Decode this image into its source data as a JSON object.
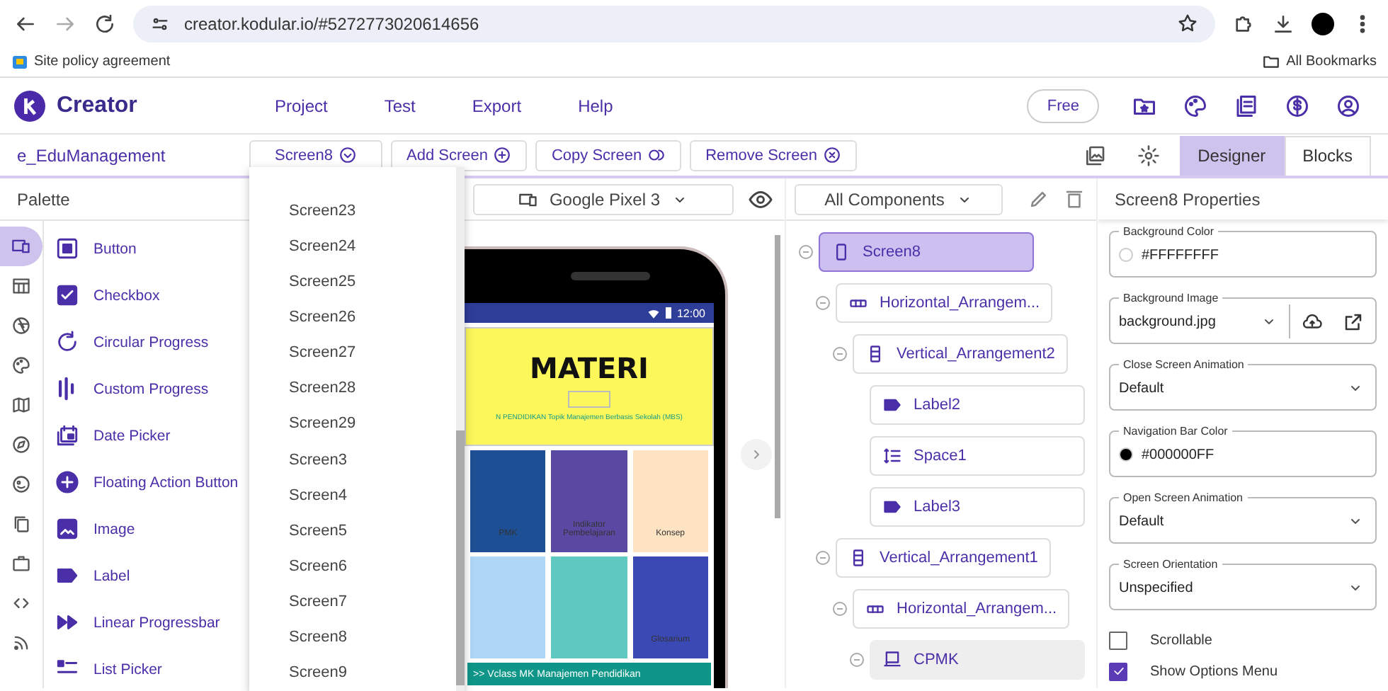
{
  "browser": {
    "url": "creator.kodular.io/#5272773020614656",
    "bookmark": "Site policy agreement",
    "all_bookmarks": "All Bookmarks"
  },
  "header": {
    "brand": "Creator",
    "menu": [
      "Project",
      "Test",
      "Export",
      "Help"
    ],
    "plan": "Free"
  },
  "toolbar": {
    "project": "e_EduManagement",
    "current_screen": "Screen8",
    "actions": [
      {
        "label": "Add Screen",
        "kind": "add"
      },
      {
        "label": "Copy Screen",
        "kind": "copy"
      },
      {
        "label": "Remove Screen",
        "kind": "remove"
      }
    ],
    "views": [
      {
        "label": "Designer",
        "selected": true
      },
      {
        "label": "Blocks",
        "selected": false
      }
    ]
  },
  "palette": {
    "title": "Palette",
    "categories": [
      {
        "kind": "devices",
        "selected": true
      },
      {
        "kind": "table",
        "selected": false
      },
      {
        "kind": "aperture",
        "selected": false
      },
      {
        "kind": "palette",
        "selected": false
      },
      {
        "kind": "map",
        "selected": false
      },
      {
        "kind": "compass",
        "selected": false
      },
      {
        "kind": "face",
        "selected": false
      },
      {
        "kind": "copy",
        "selected": false
      },
      {
        "kind": "briefcase",
        "selected": false
      },
      {
        "kind": "code",
        "selected": false
      },
      {
        "kind": "rss",
        "selected": false
      }
    ],
    "items": [
      {
        "label": "Button",
        "kind": "button"
      },
      {
        "label": "Checkbox",
        "kind": "checkbox"
      },
      {
        "label": "Circular Progress",
        "kind": "circular"
      },
      {
        "label": "Custom Progress",
        "kind": "bars"
      },
      {
        "label": "Date Picker",
        "kind": "date"
      },
      {
        "label": "Floating Action Button",
        "kind": "fab"
      },
      {
        "label": "Image",
        "kind": "image"
      },
      {
        "label": "Label",
        "kind": "label"
      },
      {
        "label": "Linear Progressbar",
        "kind": "linear"
      },
      {
        "label": "List Picker",
        "kind": "list"
      }
    ]
  },
  "screen_menu": [
    "Screen23",
    "Screen24",
    "Screen25",
    "Screen26",
    "Screen27",
    "Screen28",
    "Screen29",
    "Screen3",
    "Screen4",
    "Screen5",
    "Screen6",
    "Screen7",
    "Screen8",
    "Screen9"
  ],
  "viewer": {
    "device": "Google Pixel 3",
    "phone": {
      "time": "12:00",
      "title": "MATERI",
      "subtitle": "N PENDIDIKAN Topik Manajemen Berbasis Sekolah (MBS)",
      "tiles": [
        {
          "label": "PMK",
          "color": "#1d4f94"
        },
        {
          "label": "Indikator Pembelajaran",
          "color": "#5a49a3"
        },
        {
          "label": "Konsep",
          "color": "#fde3c2"
        },
        {
          "color": "#aed6f5"
        },
        {
          "color": "#5ec9bf"
        },
        {
          "label": "Glosarium",
          "color": "#3b49b5"
        }
      ],
      "footer": ">> Vclass MK Manajemen Pendidikan"
    }
  },
  "components": {
    "filter": "All Components",
    "tree": [
      {
        "name": "Screen8",
        "kind": "screen",
        "selected": true,
        "expanded": true,
        "children": [
          {
            "name": "Horizontal_Arrangem...",
            "kind": "horizontal",
            "selected": false,
            "expanded": true,
            "children": [
              {
                "name": "Vertical_Arrangement2",
                "kind": "vertical",
                "selected": false,
                "expanded": true,
                "children": [
                  {
                    "name": "Label2",
                    "kind": "label",
                    "selected": false
                  },
                  {
                    "name": "Space1",
                    "kind": "space",
                    "selected": false
                  },
                  {
                    "name": "Label3",
                    "kind": "label",
                    "selected": false
                  }
                ]
              }
            ]
          },
          {
            "name": "Vertical_Arrangement1",
            "kind": "vertical",
            "selected": false,
            "expanded": true,
            "children": [
              {
                "name": "Horizontal_Arrangem...",
                "kind": "horizontal",
                "selected": false,
                "expanded": true,
                "children": [
                  {
                    "name": "CPMK",
                    "kind": "card",
                    "selected": false,
                    "hovered": true,
                    "expanded": true
                  }
                ]
              }
            ]
          }
        ]
      }
    ]
  },
  "properties": {
    "title": "Screen8 Properties",
    "fields": [
      {
        "kind": "color",
        "label": "Background Color",
        "value": "#FFFFFFFF",
        "color": "#ffffff"
      },
      {
        "kind": "asset",
        "label": "Background Image",
        "value": "background.jpg"
      },
      {
        "kind": "select",
        "label": "Close Screen Animation",
        "value": "Default"
      },
      {
        "kind": "color",
        "label": "Navigation Bar Color",
        "value": "#000000FF",
        "color": "#000000"
      },
      {
        "kind": "select",
        "label": "Open Screen Animation",
        "value": "Default"
      },
      {
        "kind": "select",
        "label": "Screen Orientation",
        "value": "Unspecified"
      },
      {
        "kind": "checkbox",
        "label": "Scrollable",
        "checked": false
      },
      {
        "kind": "checkbox",
        "label": "Show Options Menu",
        "checked": true
      }
    ]
  }
}
